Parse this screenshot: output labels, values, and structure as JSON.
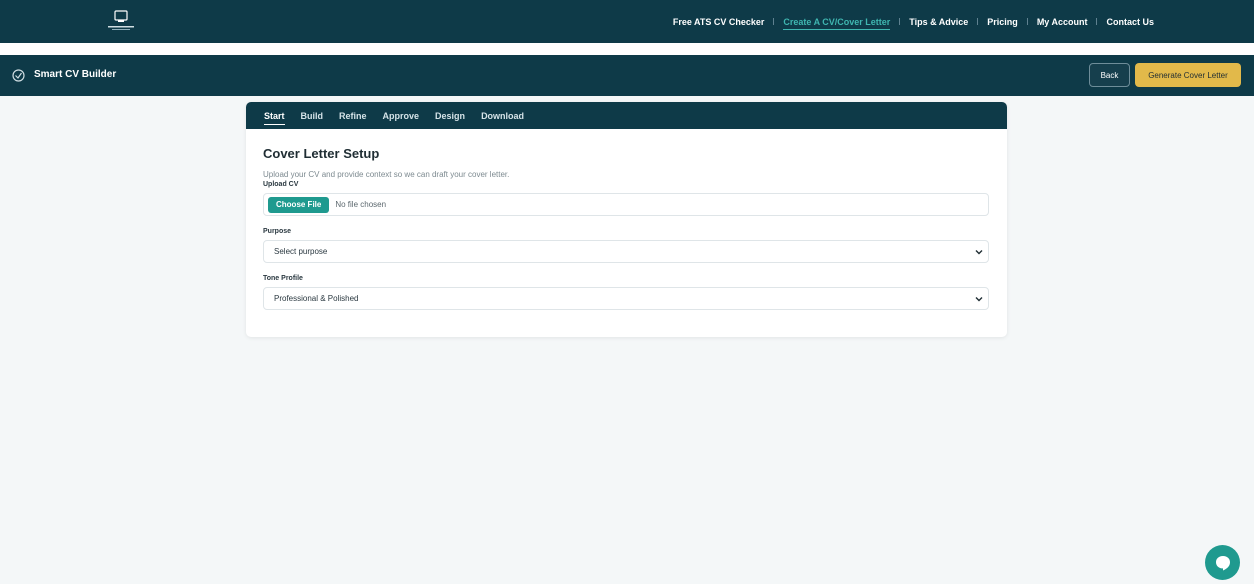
{
  "nav": {
    "links": [
      {
        "label": "Free ATS CV Checker",
        "active": false
      },
      {
        "label": "Create A CV/Cover Letter",
        "active": true
      },
      {
        "label": "Tips & Advice",
        "active": false
      },
      {
        "label": "Pricing",
        "active": false
      },
      {
        "label": "My Account",
        "active": false
      },
      {
        "label": "Contact Us",
        "active": false
      }
    ]
  },
  "appbar": {
    "title": "Smart CV Builder",
    "back_label": "Back",
    "generate_label": "Generate Cover Letter"
  },
  "tabs": [
    {
      "label": "Start",
      "active": true
    },
    {
      "label": "Build",
      "active": false
    },
    {
      "label": "Refine",
      "active": false
    },
    {
      "label": "Approve",
      "active": false
    },
    {
      "label": "Design",
      "active": false
    },
    {
      "label": "Download",
      "active": false
    }
  ],
  "setup": {
    "title": "Cover Letter Setup",
    "description": "Upload your CV and provide context so we can draft your cover letter.",
    "upload_label": "Upload CV",
    "choose_file_label": "Choose File",
    "file_status": "No file chosen",
    "purpose_label": "Purpose",
    "purpose_value": "Select purpose",
    "tone_label": "Tone Profile",
    "tone_value": "Professional & Polished"
  },
  "colors": {
    "header_bg": "#0e3a48",
    "accent_teal": "#1f9a8f",
    "generate_yellow": "#e2b94a",
    "page_bg": "#f4f7f8"
  },
  "icons": [
    "logo-icon",
    "app-icon",
    "chevron-down-icon",
    "chat-icon"
  ]
}
